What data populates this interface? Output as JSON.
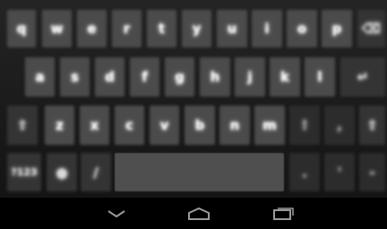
{
  "keyboard": {
    "row1": [
      "q",
      "w",
      "e",
      "r",
      "t",
      "y",
      "u",
      "i",
      "o",
      "p",
      "⌫"
    ],
    "row2": [
      "a",
      "s",
      "d",
      "f",
      "g",
      "h",
      "j",
      "k",
      "l",
      "↵"
    ],
    "row3": [
      "⇧",
      "z",
      "x",
      "c",
      "v",
      "b",
      "n",
      "m",
      "!",
      ",",
      "?",
      "⇧"
    ],
    "row4": {
      "symbols": "?123",
      "mic": "●",
      "slash": "/",
      "dot": ".",
      "comma": "'",
      "emoji": "-"
    }
  },
  "navbar": {
    "back": "chevron-down-icon",
    "home": "home-icon",
    "recents": "recents-icon"
  },
  "colors": {
    "key_alpha": "#4b4b4b",
    "key_function": "#343434",
    "keyboard_background": "#1b1b1b",
    "navbar_background": "#000000",
    "icon": "#9a9a9a"
  }
}
